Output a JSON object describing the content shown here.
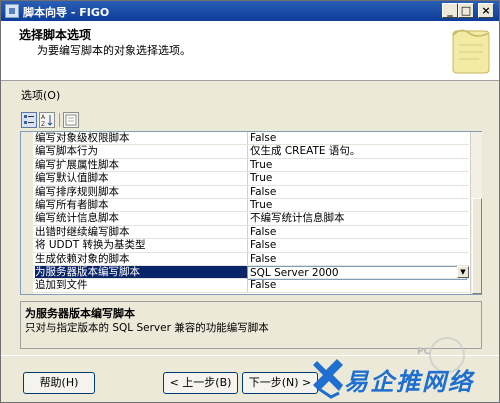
{
  "window": {
    "title": "脚本向导 - FIGO"
  },
  "title_buttons": {
    "minimize": "_",
    "maximize": "□",
    "close": "×"
  },
  "header": {
    "title": "选择脚本选项",
    "subtitle": "为要编写脚本的对象选择选项。"
  },
  "options_label": "选项(O)",
  "grid": {
    "rows": [
      {
        "name": "编写对象级权限脚本",
        "value": "False"
      },
      {
        "name": "编写脚本行为",
        "value": "仅生成 CREATE 语句。"
      },
      {
        "name": "编写扩展属性脚本",
        "value": "True"
      },
      {
        "name": "编写默认值脚本",
        "value": "True"
      },
      {
        "name": "编写排序规则脚本",
        "value": "False"
      },
      {
        "name": "编写所有者脚本",
        "value": "True"
      },
      {
        "name": "编写统计信息脚本",
        "value": "不编写统计信息脚本"
      },
      {
        "name": "出错时继续编写脚本",
        "value": "False"
      },
      {
        "name": "将 UDDT 转换为基类型",
        "value": "False"
      },
      {
        "name": "生成依赖对象的脚本",
        "value": "False"
      },
      {
        "name": "为服务器版本编写脚本",
        "value": "SQL Server 2000",
        "selected": true
      },
      {
        "name": "追加到文件",
        "value": "False"
      }
    ]
  },
  "description": {
    "title": "为服务器版本编写脚本",
    "text": "只对与指定版本的 SQL Server 兼容的功能编写脚本"
  },
  "buttons": {
    "help": "帮助(H)",
    "back": "< 上一步(B)",
    "next": "下一步(N) >"
  },
  "watermark": {
    "text": "易企推网络",
    "badge": "PC"
  },
  "colors": {
    "titlebar": "#0c3d99",
    "selection": "#0a246a",
    "watermark": "#1f6fd0"
  }
}
